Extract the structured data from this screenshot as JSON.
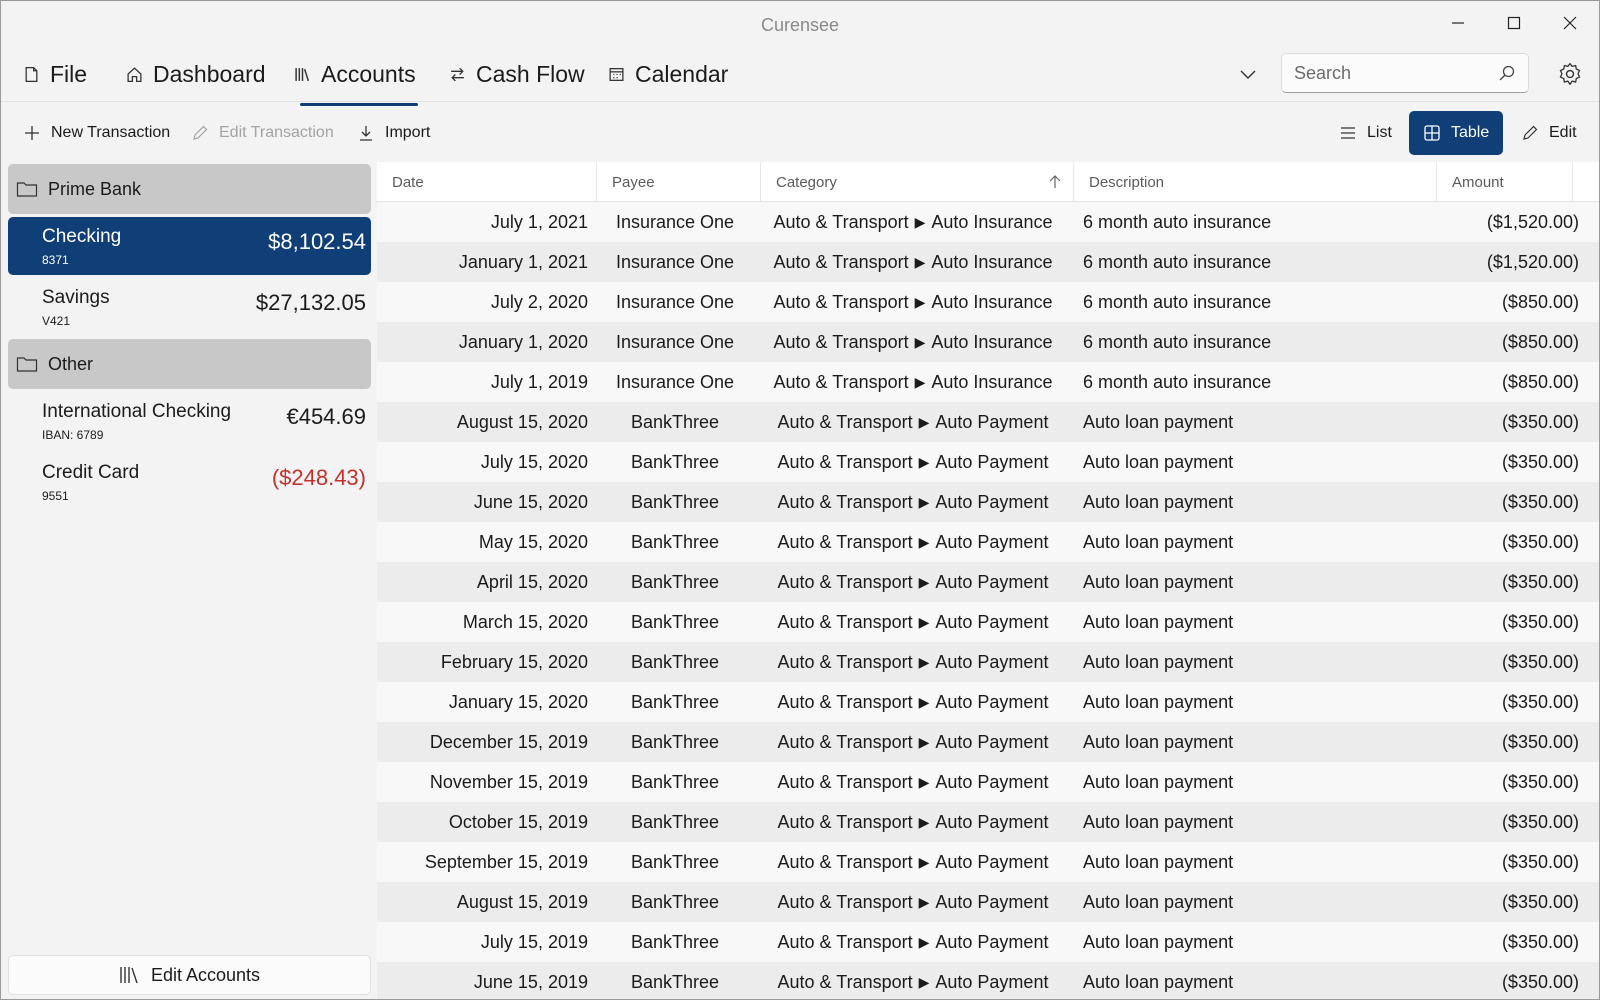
{
  "window": {
    "title": "Curensee"
  },
  "nav": {
    "file": "File",
    "dashboard": "Dashboard",
    "accounts": "Accounts",
    "cash_flow": "Cash Flow",
    "calendar": "Calendar",
    "search_placeholder": "Search"
  },
  "toolbar": {
    "new_transaction": "New Transaction",
    "edit_transaction": "Edit Transaction",
    "import": "Import",
    "list": "List",
    "table": "Table",
    "edit": "Edit"
  },
  "sidebar": {
    "groups": [
      {
        "name": "Prime Bank"
      },
      {
        "name": "Other"
      }
    ],
    "accounts": [
      {
        "name": "Checking",
        "number": "8371",
        "balance": "$8,102.54"
      },
      {
        "name": "Savings",
        "number": "V421",
        "balance": "$27,132.05"
      },
      {
        "name": "International Checking",
        "number": "IBAN: 6789",
        "balance": "€454.69"
      },
      {
        "name": "Credit Card",
        "number": "9551",
        "balance": "($248.43)"
      }
    ],
    "edit_accounts": "Edit Accounts"
  },
  "table": {
    "columns": [
      "Date",
      "Payee",
      "Category",
      "Description",
      "Amount"
    ],
    "rows": [
      {
        "date": "July 1, 2021",
        "payee": "Insurance One",
        "cat1": "Auto & Transport",
        "cat2": "Auto Insurance",
        "desc": "6 month auto insurance",
        "amount": "($1,520.00)"
      },
      {
        "date": "January 1, 2021",
        "payee": "Insurance One",
        "cat1": "Auto & Transport",
        "cat2": "Auto Insurance",
        "desc": "6 month auto insurance",
        "amount": "($1,520.00)"
      },
      {
        "date": "July 2, 2020",
        "payee": "Insurance One",
        "cat1": "Auto & Transport",
        "cat2": "Auto Insurance",
        "desc": "6 month auto insurance",
        "amount": "($850.00)"
      },
      {
        "date": "January 1, 2020",
        "payee": "Insurance One",
        "cat1": "Auto & Transport",
        "cat2": "Auto Insurance",
        "desc": "6 month auto insurance",
        "amount": "($850.00)"
      },
      {
        "date": "July 1, 2019",
        "payee": "Insurance One",
        "cat1": "Auto & Transport",
        "cat2": "Auto Insurance",
        "desc": "6 month auto insurance",
        "amount": "($850.00)"
      },
      {
        "date": "August 15, 2020",
        "payee": "BankThree",
        "cat1": "Auto & Transport",
        "cat2": "Auto Payment",
        "desc": "Auto loan payment",
        "amount": "($350.00)"
      },
      {
        "date": "July 15, 2020",
        "payee": "BankThree",
        "cat1": "Auto & Transport",
        "cat2": "Auto Payment",
        "desc": "Auto loan payment",
        "amount": "($350.00)"
      },
      {
        "date": "June 15, 2020",
        "payee": "BankThree",
        "cat1": "Auto & Transport",
        "cat2": "Auto Payment",
        "desc": "Auto loan payment",
        "amount": "($350.00)"
      },
      {
        "date": "May 15, 2020",
        "payee": "BankThree",
        "cat1": "Auto & Transport",
        "cat2": "Auto Payment",
        "desc": "Auto loan payment",
        "amount": "($350.00)"
      },
      {
        "date": "April 15, 2020",
        "payee": "BankThree",
        "cat1": "Auto & Transport",
        "cat2": "Auto Payment",
        "desc": "Auto loan payment",
        "amount": "($350.00)"
      },
      {
        "date": "March 15, 2020",
        "payee": "BankThree",
        "cat1": "Auto & Transport",
        "cat2": "Auto Payment",
        "desc": "Auto loan payment",
        "amount": "($350.00)"
      },
      {
        "date": "February 15, 2020",
        "payee": "BankThree",
        "cat1": "Auto & Transport",
        "cat2": "Auto Payment",
        "desc": "Auto loan payment",
        "amount": "($350.00)"
      },
      {
        "date": "January 15, 2020",
        "payee": "BankThree",
        "cat1": "Auto & Transport",
        "cat2": "Auto Payment",
        "desc": "Auto loan payment",
        "amount": "($350.00)"
      },
      {
        "date": "December 15, 2019",
        "payee": "BankThree",
        "cat1": "Auto & Transport",
        "cat2": "Auto Payment",
        "desc": "Auto loan payment",
        "amount": "($350.00)"
      },
      {
        "date": "November 15, 2019",
        "payee": "BankThree",
        "cat1": "Auto & Transport",
        "cat2": "Auto Payment",
        "desc": "Auto loan payment",
        "amount": "($350.00)"
      },
      {
        "date": "October 15, 2019",
        "payee": "BankThree",
        "cat1": "Auto & Transport",
        "cat2": "Auto Payment",
        "desc": "Auto loan payment",
        "amount": "($350.00)"
      },
      {
        "date": "September 15, 2019",
        "payee": "BankThree",
        "cat1": "Auto & Transport",
        "cat2": "Auto Payment",
        "desc": "Auto loan payment",
        "amount": "($350.00)"
      },
      {
        "date": "August 15, 2019",
        "payee": "BankThree",
        "cat1": "Auto & Transport",
        "cat2": "Auto Payment",
        "desc": "Auto loan payment",
        "amount": "($350.00)"
      },
      {
        "date": "July 15, 2019",
        "payee": "BankThree",
        "cat1": "Auto & Transport",
        "cat2": "Auto Payment",
        "desc": "Auto loan payment",
        "amount": "($350.00)"
      },
      {
        "date": "June 15, 2019",
        "payee": "BankThree",
        "cat1": "Auto & Transport",
        "cat2": "Auto Payment",
        "desc": "Auto loan payment",
        "amount": "($350.00)"
      }
    ]
  },
  "colors": {
    "accent": "#0f3f76",
    "negative": "#c4312b",
    "group_header": "#c8c8c8"
  }
}
